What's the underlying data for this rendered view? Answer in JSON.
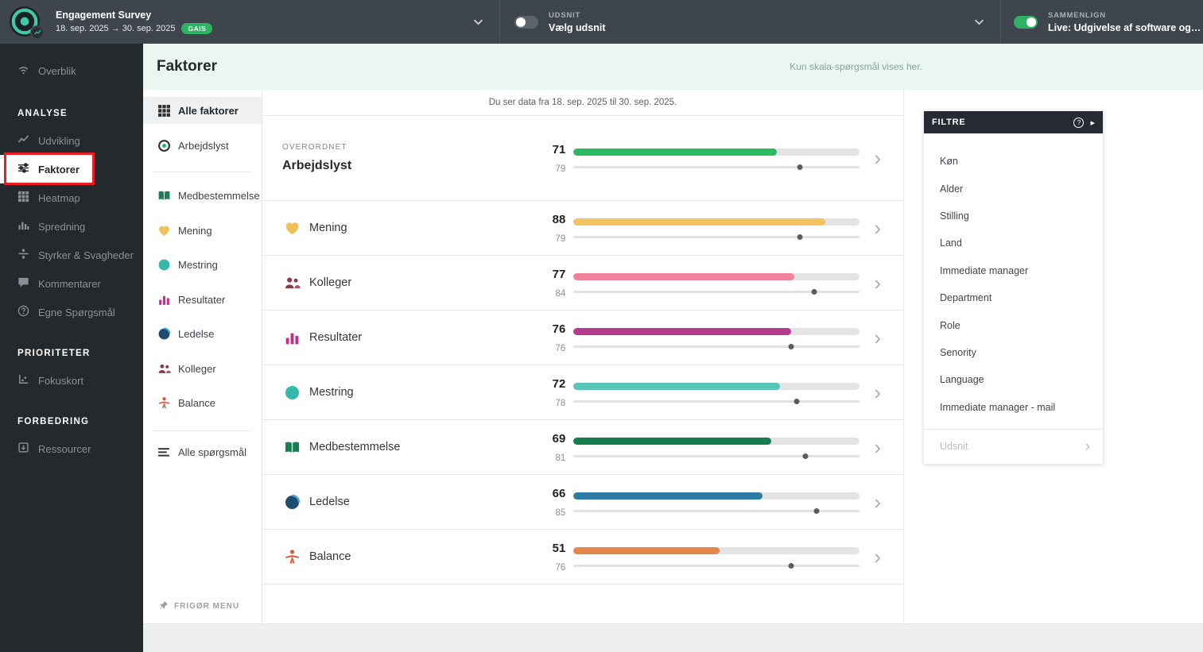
{
  "topbar": {
    "survey_title": "Engagement Survey",
    "survey_dates": "18. sep. 2025 → 30. sep. 2025",
    "survey_badge": "GAIS",
    "udsnit_label": "UDSNIT",
    "udsnit_value": "Vælg udsnit",
    "sammenlign_label": "SAMMENLIGN",
    "sammenlign_value": "Live: Udgivelse af software og computer...",
    "accent_green": "#2fb261"
  },
  "sidebar": {
    "overblik": "Overblik",
    "sections": [
      {
        "title": "ANALYSE",
        "items": [
          "Udvikling",
          "Faktorer",
          "Heatmap",
          "Spredning",
          "Styrker & Svagheder",
          "Kommentarer",
          "Egne Spørgsmål"
        ]
      },
      {
        "title": "PRIORITETER",
        "items": [
          "Fokuskort"
        ]
      },
      {
        "title": "FORBEDRING",
        "items": [
          "Ressourcer"
        ]
      }
    ],
    "active_item": "Faktorer",
    "annotation_color": "#ea1d25"
  },
  "page": {
    "title": "Faktorer",
    "note": "Kun skala-spørgsmål vises her."
  },
  "submenu": {
    "all_factors": "Alle faktorer",
    "arbejdslyst": "Arbejdslyst",
    "factors": [
      {
        "label": "Medbestemmelse",
        "icon": "book-icon",
        "color": "#1b7e4e"
      },
      {
        "label": "Mening",
        "icon": "heart-icon",
        "color": "#efc259"
      },
      {
        "label": "Mestring",
        "icon": "circle-icon",
        "color": "#35b8aa"
      },
      {
        "label": "Resultater",
        "icon": "bars-icon",
        "color": "#c2308d"
      },
      {
        "label": "Ledelse",
        "icon": "circle-icon",
        "color": "#1d4e6e"
      },
      {
        "label": "Kolleger",
        "icon": "people-icon",
        "color": "#8f3b46"
      },
      {
        "label": "Balance",
        "icon": "person-icon",
        "color": "#d9583c"
      }
    ],
    "all_questions": "Alle spørgsmål",
    "release_menu": "FRIGØR MENU"
  },
  "list": {
    "date_note": "Du ser data fra 18. sep. 2025 til 30. sep. 2025.",
    "overall_label": "OVERORDNET",
    "rows": [
      {
        "name": "Arbejdslyst",
        "score": 71,
        "benchmark": 79,
        "color": "#2db863",
        "icon": "",
        "icon_color": ""
      },
      {
        "name": "Mening",
        "score": 88,
        "benchmark": 79,
        "color": "#f3c363",
        "icon": "heart-icon",
        "icon_color": "#efc259"
      },
      {
        "name": "Kolleger",
        "score": 77,
        "benchmark": 84,
        "color": "#f0839b",
        "icon": "people-icon",
        "icon_color": "#8f3b46"
      },
      {
        "name": "Resultater",
        "score": 76,
        "benchmark": 76,
        "color": "#b63b8f",
        "icon": "bars-icon",
        "icon_color": "#c2308d"
      },
      {
        "name": "Mestring",
        "score": 72,
        "benchmark": 78,
        "color": "#57c6b7",
        "icon": "circle-icon",
        "icon_color": "#35b8aa"
      },
      {
        "name": "Medbestemmelse",
        "score": 69,
        "benchmark": 81,
        "color": "#157c4b",
        "icon": "book-icon",
        "icon_color": "#1b7e4e"
      },
      {
        "name": "Ledelse",
        "score": 66,
        "benchmark": 85,
        "color": "#2d7aa4",
        "icon": "circle-icon",
        "icon_color": "#1d4e6e"
      },
      {
        "name": "Balance",
        "score": 51,
        "benchmark": 76,
        "color": "#e1874a",
        "icon": "person-icon",
        "icon_color": "#d9583c"
      }
    ]
  },
  "filters": {
    "title": "FILTRE",
    "items": [
      "Køn",
      "Alder",
      "Stilling",
      "Land",
      "Immediate manager",
      "Department",
      "Role",
      "Senority",
      "Language",
      "Immediate manager - mail"
    ],
    "udsnit": "Udsnit"
  }
}
